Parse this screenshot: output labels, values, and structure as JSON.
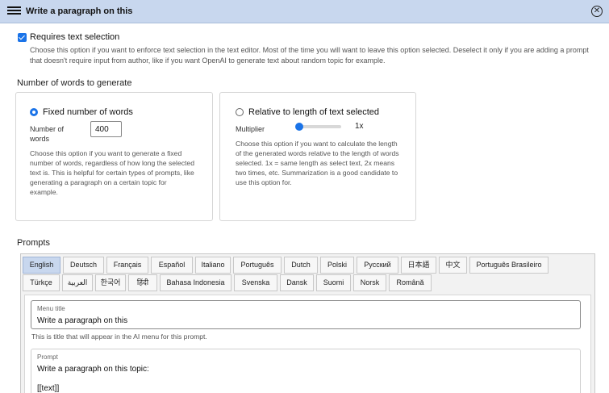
{
  "titlebar": {
    "title": "Write a paragraph on this"
  },
  "requires_selection": {
    "checked": true,
    "label": "Requires text selection",
    "description": "Choose this option if you want to enforce text selection in the text editor. Most of the time you will want to leave this option selected. Deselect it only if you are adding a prompt that doesn't require input from author, like if you want OpenAI to generate text about random topic for example."
  },
  "words_section": {
    "heading": "Number of words to generate",
    "fixed": {
      "selected": true,
      "label": "Fixed number of words",
      "input_label": "Number of words",
      "input_value": "400",
      "description": "Choose this option if you want to generate a fixed number of words, regardless of how long the selected text is. This is helpful for certain types of prompts, like generating a paragraph on a certain topic for example."
    },
    "relative": {
      "selected": false,
      "label": "Relative to length of text selected",
      "multiplier_label": "Multiplier",
      "multiplier_value": "1x",
      "multiplier_level": 0,
      "description": "Choose this option if you want to calculate the length of the generated words relative to the length of words selected. 1x = same length as select text, 2x means two times, etc. Summarization is a good candidate to use this option for."
    }
  },
  "prompts": {
    "heading": "Prompts",
    "tabs_row1": [
      "English",
      "Deutsch",
      "Français",
      "Español",
      "Italiano",
      "Português",
      "Dutch",
      "Polski",
      "Русский",
      "日本語",
      "中文",
      "Português Brasileiro"
    ],
    "tabs_row2": [
      "Türkçe",
      "العربية",
      "한국어",
      "हिंदी",
      "Bahasa Indonesia",
      "Svenska",
      "Dansk",
      "Suomi",
      "Norsk",
      "Română"
    ],
    "active_tab": "English",
    "menu_title": {
      "label": "Menu title",
      "value": "Write a paragraph on this",
      "help": "This is title that will appear in the AI menu for this prompt."
    },
    "prompt": {
      "label": "Prompt",
      "line1": "Write a paragraph on this topic:",
      "line2": "[[text]]"
    }
  }
}
